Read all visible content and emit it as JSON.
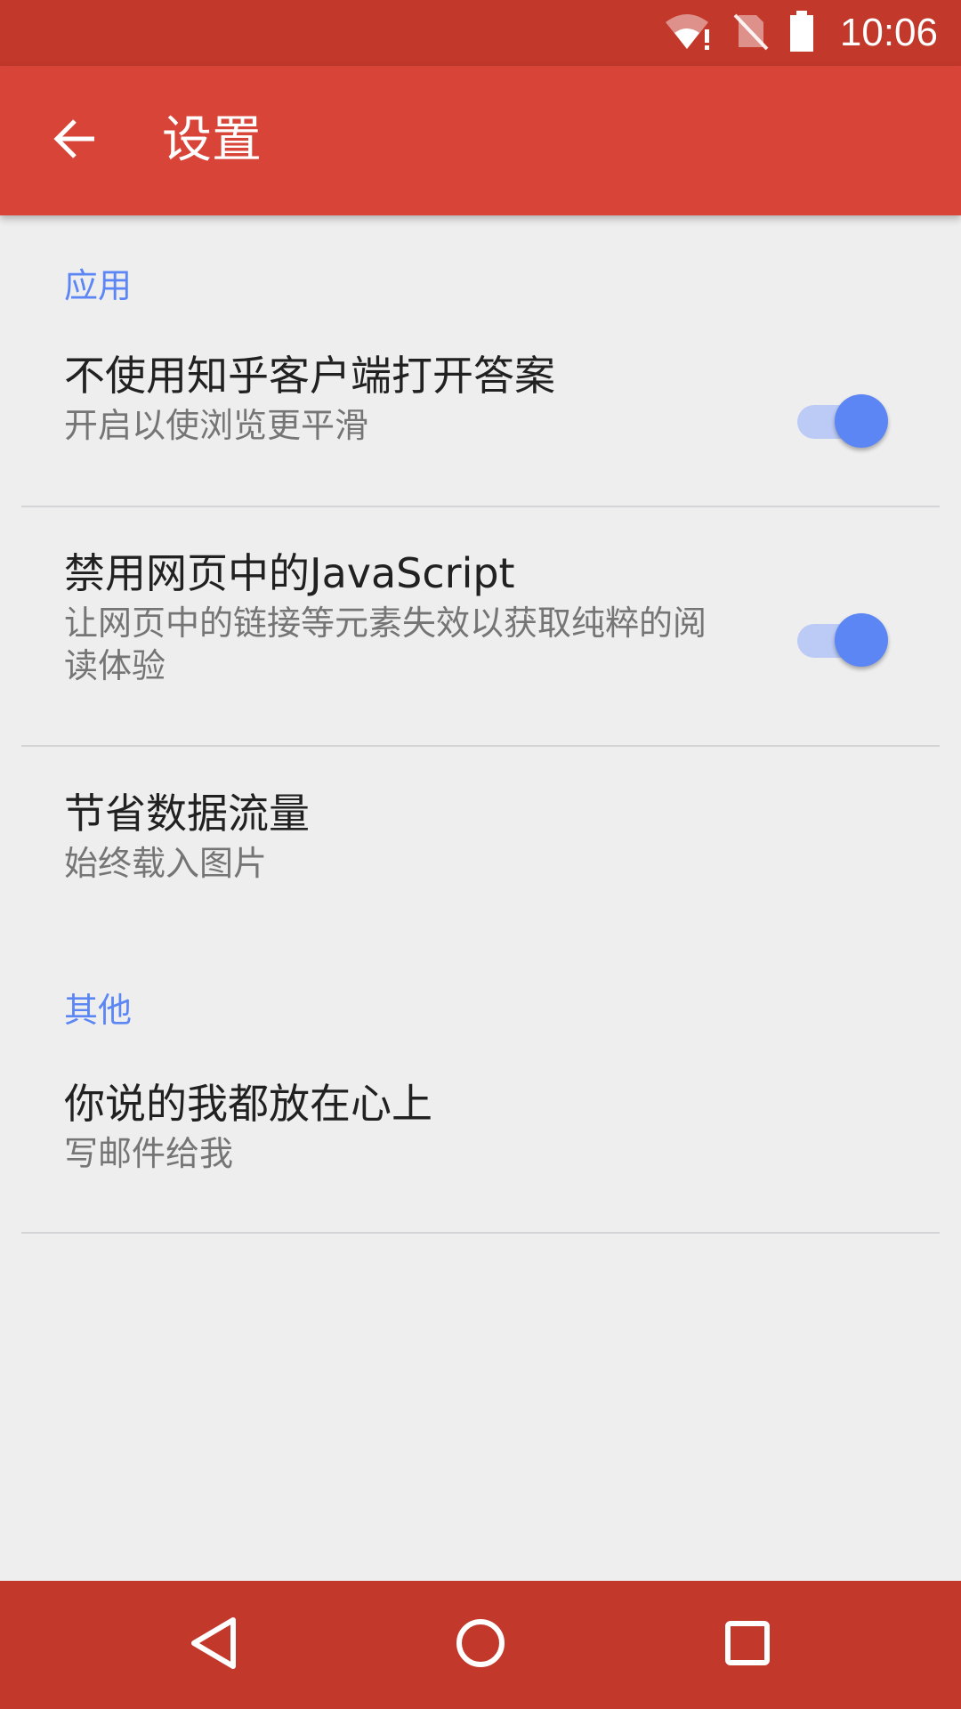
{
  "status_bar": {
    "time": "10:06",
    "icons": [
      "wifi-alert-icon",
      "no-sim-icon",
      "battery-icon"
    ]
  },
  "app_bar": {
    "back_icon": "arrow-back-icon",
    "title": "设置"
  },
  "sections": [
    {
      "header": "应用",
      "items": [
        {
          "title": "不使用知乎客户端打开答案",
          "summary": "开启以使浏览更平滑",
          "toggle": true
        },
        {
          "title": "禁用网页中的JavaScript",
          "summary": "让网页中的链接等元素失效以获取纯粹的阅读体验",
          "toggle": true
        },
        {
          "title": "节省数据流量",
          "summary": "始终载入图片"
        }
      ]
    },
    {
      "header": "其他",
      "items": [
        {
          "title": "你说的我都放在心上",
          "summary": "写邮件给我"
        }
      ]
    }
  ],
  "nav_bar": {
    "icons": [
      "back-triangle-icon",
      "home-circle-icon",
      "recents-square-icon"
    ]
  },
  "colors": {
    "status_bar": "#c2382a",
    "app_bar": "#d84438",
    "accent": "#5b86f4",
    "background": "#eeeeef"
  }
}
